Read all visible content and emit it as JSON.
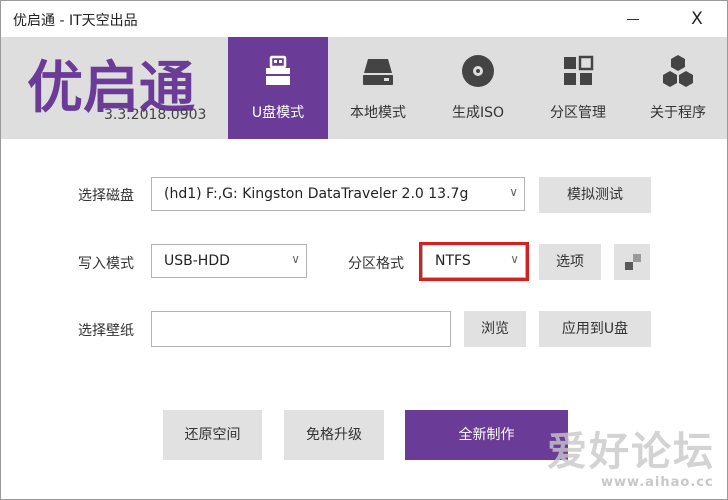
{
  "window": {
    "title": "优启通 - IT天空出品",
    "minimize_icon": "minimize-icon",
    "close_label": "X"
  },
  "header": {
    "logo": "优启通",
    "version": "3.3.2018.0903",
    "tabs": [
      {
        "label": "U盘模式",
        "icon": "usb-drive-icon",
        "active": true
      },
      {
        "label": "本地模式",
        "icon": "hard-disk-icon",
        "active": false
      },
      {
        "label": "生成ISO",
        "icon": "disc-icon",
        "active": false
      },
      {
        "label": "分区管理",
        "icon": "partition-grid-icon",
        "active": false
      },
      {
        "label": "关于程序",
        "icon": "hexagons-icon",
        "active": false
      }
    ]
  },
  "form": {
    "disk_label": "选择磁盘",
    "disk_value": "(hd1) F:,G: Kingston DataTraveler 2.0 13.7g",
    "simulate_button": "模拟测试",
    "write_mode_label": "写入模式",
    "write_mode_value": "USB-HDD",
    "partition_format_label": "分区格式",
    "partition_format_value": "NTFS",
    "options_button": "选项",
    "wallpaper_label": "选择壁纸",
    "wallpaper_value": "",
    "browse_button": "浏览",
    "apply_button": "应用到U盘"
  },
  "footer": {
    "restore_button": "还原空间",
    "upgrade_button": "免格升级",
    "create_button": "全新制作"
  },
  "watermark": {
    "text": "爱好论坛",
    "url": "www.aihao.cc"
  },
  "colors": {
    "accent": "#6a3b97",
    "header_bg": "#dedede",
    "button_bg": "#e1e1e1",
    "highlight": "#d62020"
  }
}
